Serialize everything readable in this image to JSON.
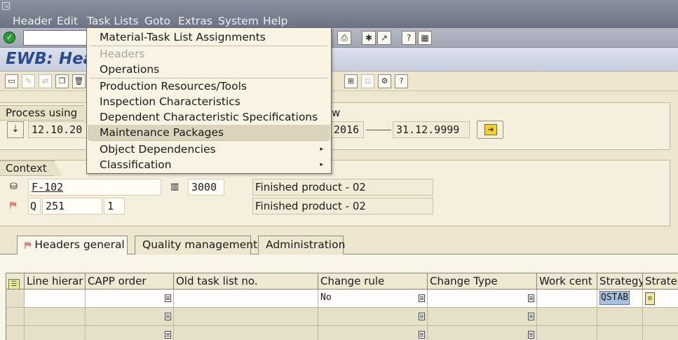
{
  "menubar": {
    "items": [
      "Header",
      "Edit",
      "Task Lists",
      "Goto",
      "Extras",
      "System",
      "Help"
    ]
  },
  "title": "EWB: Hea",
  "dropdown": {
    "items": [
      {
        "label": "Material-Task List Assignments",
        "disabled": false
      },
      {
        "label": "Headers",
        "disabled": true
      },
      {
        "label": "Operations",
        "disabled": false
      },
      {
        "label": "Production Resources/Tools",
        "disabled": false
      },
      {
        "label": "Inspection Characteristics",
        "disabled": false
      },
      {
        "label": "Dependent Characteristic Specifications",
        "disabled": false
      },
      {
        "label": "Maintenance Packages",
        "disabled": false,
        "highlighted": true
      },
      {
        "label": "Object Dependencies",
        "disabled": false,
        "submenu": true
      },
      {
        "label": "Classification",
        "disabled": false,
        "submenu": true
      }
    ]
  },
  "process": {
    "label": "Process using",
    "date_from": "12.10.20",
    "date_from2": "2016",
    "date_to": "31.12.9999",
    "w_label": "w"
  },
  "context": {
    "label": "Context",
    "material": "F-102",
    "plant": "3000",
    "material_desc": "Finished product - 02",
    "tasklist_type": "Q",
    "group": "251",
    "counter": "1",
    "tasklist_desc": "Finished product - 02"
  },
  "tabs": [
    "Headers general",
    "Quality management",
    "Administration"
  ],
  "table": {
    "columns": [
      "Line hierar",
      "CAPP order",
      "Old task list no.",
      "Change rule",
      "Change Type",
      "Work cent",
      "Strategy",
      "Strateg"
    ],
    "row1": {
      "change_rule": "No",
      "strategy": "QSTAB"
    }
  },
  "colors": {
    "menubar": "#7d8391",
    "title": "#2c4c8d",
    "background": "#efe6cf"
  }
}
